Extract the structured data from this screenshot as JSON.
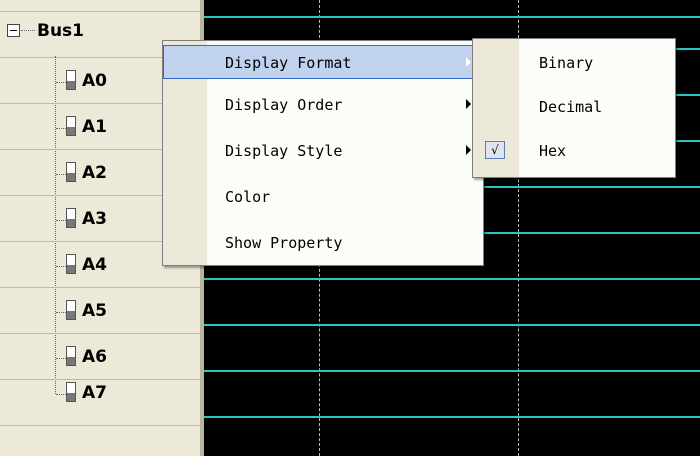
{
  "tree": {
    "bus": {
      "label": "Bus1"
    },
    "signals": [
      {
        "label": "A0"
      },
      {
        "label": "A1"
      },
      {
        "label": "A2"
      },
      {
        "label": "A3"
      },
      {
        "label": "A4"
      },
      {
        "label": "A5"
      },
      {
        "label": "A6"
      },
      {
        "label": "A7"
      }
    ]
  },
  "context_menu": {
    "items": [
      {
        "label": "Display Format",
        "has_submenu": true,
        "highlighted": true
      },
      {
        "label": "Display Order",
        "has_submenu": true
      },
      {
        "label": "Display Style",
        "has_submenu": true
      },
      {
        "label": "Color"
      },
      {
        "label": "Show Property"
      }
    ]
  },
  "submenu": {
    "items": [
      {
        "label": "Binary",
        "checked": false
      },
      {
        "label": "Decimal",
        "checked": false
      },
      {
        "label": "Hex",
        "checked": true,
        "check_glyph": "√"
      }
    ]
  },
  "colors": {
    "waveform": "#2ec4c4",
    "panel": "#ece9d8",
    "menu_highlight": "#c1d2ee"
  }
}
